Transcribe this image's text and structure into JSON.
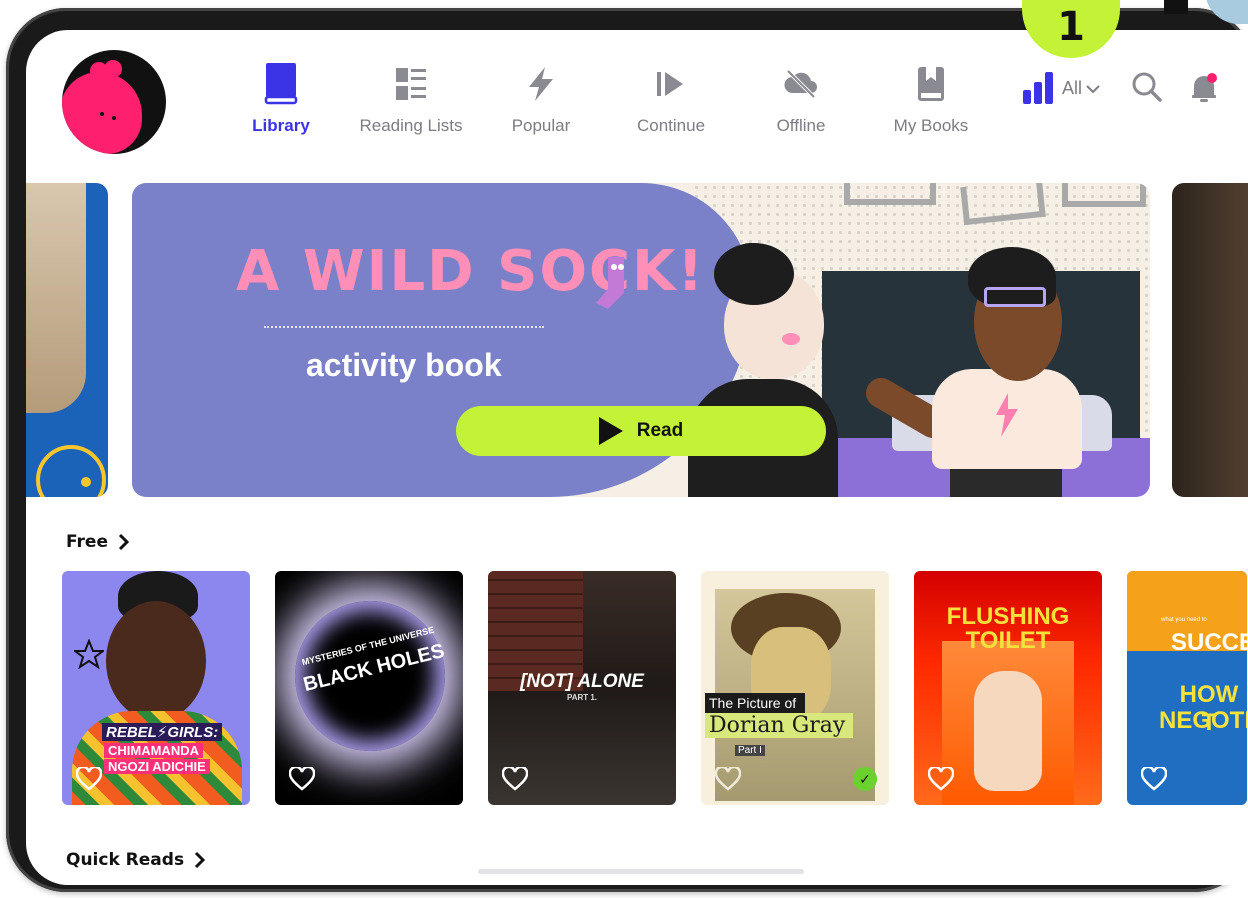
{
  "step_badge": "1",
  "nav": {
    "items": [
      {
        "label": "Library",
        "icon": "book-icon",
        "active": true
      },
      {
        "label": "Reading Lists",
        "icon": "list-icon",
        "active": false
      },
      {
        "label": "Popular",
        "icon": "lightning-icon",
        "active": false
      },
      {
        "label": "Continue",
        "icon": "play-forward-icon",
        "active": false
      },
      {
        "label": "Offline",
        "icon": "cloud-off-icon",
        "active": false
      },
      {
        "label": "My Books",
        "icon": "bookmark-book-icon",
        "active": false
      }
    ]
  },
  "header": {
    "level_icon": "reading-level-icon",
    "filter_label": "All",
    "search_icon": "search-icon",
    "notifications_icon": "bell-icon"
  },
  "hero": {
    "title": "A WILD SOCK!",
    "subtitle": "activity book",
    "cta_label": "Read"
  },
  "sections": {
    "free": {
      "title": "Free"
    },
    "quick_reads": {
      "title": "Quick Reads"
    }
  },
  "books": [
    {
      "line1": "REBEL",
      "line1b": "GIRLS:",
      "line2": "CHIMAMANDA",
      "line3": "NGOZI ADICHIE"
    },
    {
      "line1": "MYSTERIES OF THE UNIVERSE",
      "line2": "BLACK HOLES"
    },
    {
      "line1": "[NOT] ALONE",
      "line2": "PART 1."
    },
    {
      "line1": "The Picture of",
      "line2": "Dorian Gray",
      "line3": "Part I",
      "read": true
    },
    {
      "line1": "FLUSHING",
      "line2": "TOILET"
    },
    {
      "line1": "what you need to",
      "line2": "SUCCE",
      "line3": "HOW T",
      "line4": "NEGOTI"
    }
  ],
  "colors": {
    "accent": "#3b33e6",
    "cta": "#c4f237",
    "avatar": "#ff1f6f"
  }
}
